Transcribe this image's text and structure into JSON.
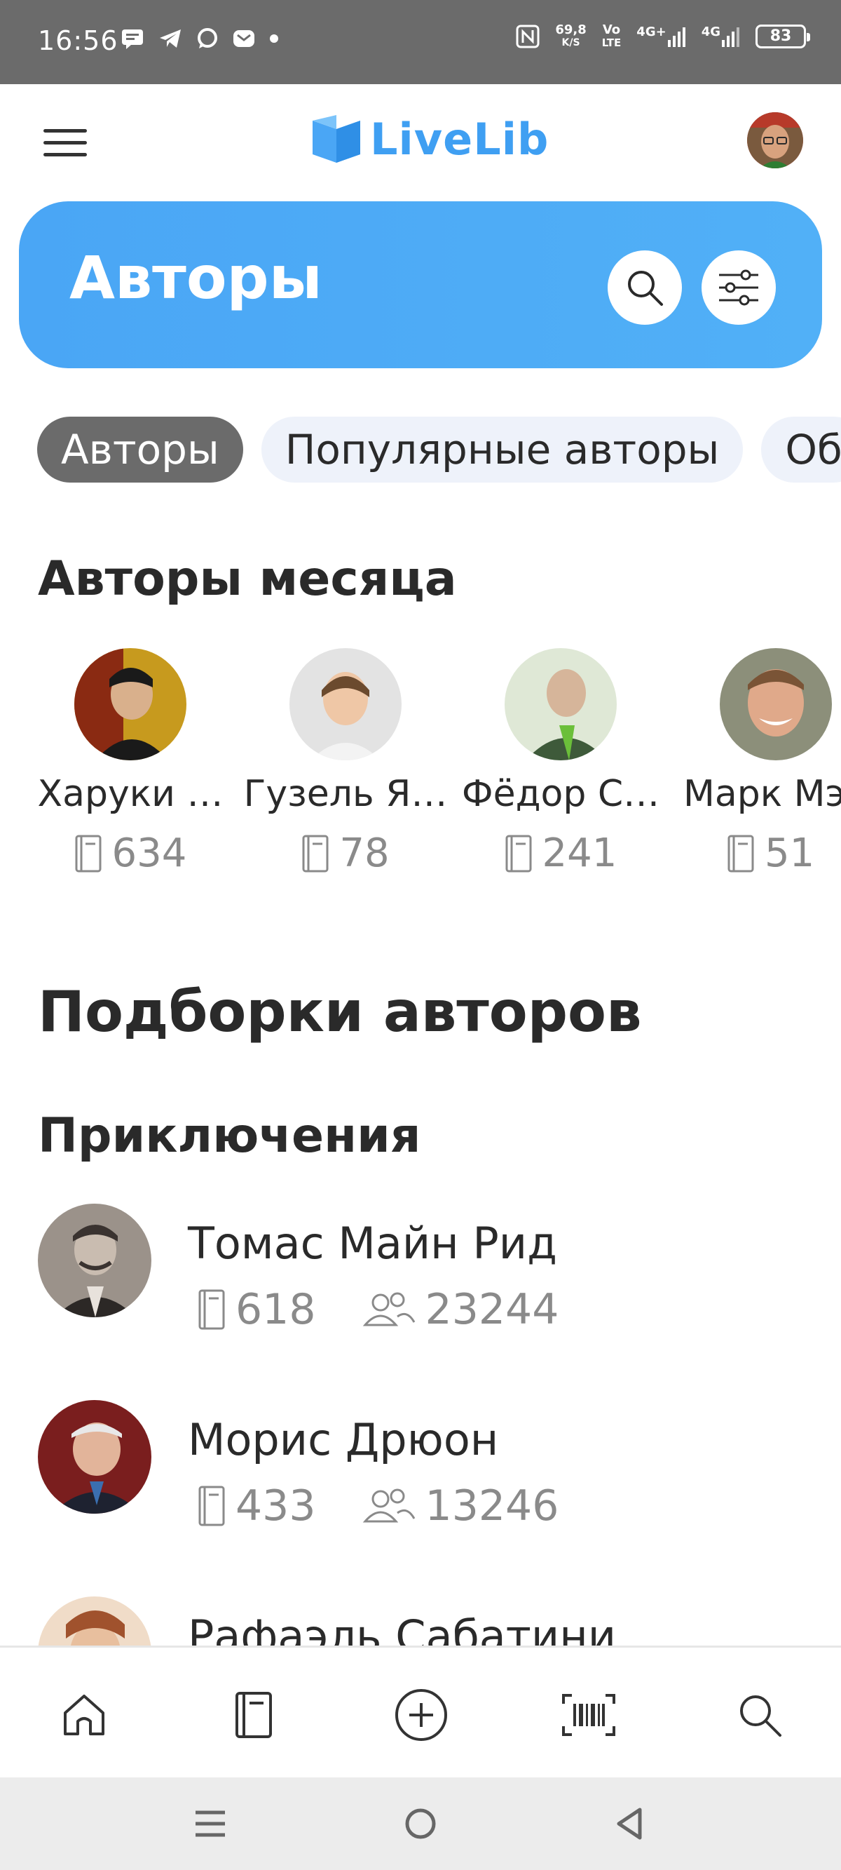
{
  "status_bar": {
    "time": "16:56",
    "speed_value": "69,8",
    "speed_unit": "K/S",
    "volte_top": "Vo",
    "volte_bottom": "LTE",
    "net1": "4G+",
    "net2": "4G",
    "battery": "83"
  },
  "header": {
    "logo_text": "LiveLib"
  },
  "banner": {
    "title": "Авторы"
  },
  "chips": [
    {
      "label": "Авторы",
      "active": true
    },
    {
      "label": "Популярные авторы",
      "active": false
    },
    {
      "label": "Об",
      "active": false
    }
  ],
  "authors_of_month": {
    "title": "Авторы месяца",
    "items": [
      {
        "name": "Харуки …",
        "books": "634"
      },
      {
        "name": "Гузель Я…",
        "books": "78"
      },
      {
        "name": "Фёдор С…",
        "books": "241"
      },
      {
        "name": "Марк Мэ…",
        "books": "51"
      }
    ]
  },
  "collections": {
    "title": "Подборки авторов",
    "adventure": {
      "title": "Приключения",
      "items": [
        {
          "name": "Томас Майн Рид",
          "books": "618",
          "readers": "23244"
        },
        {
          "name": "Морис Дрюон",
          "books": "433",
          "readers": "13246"
        },
        {
          "name": "Рафаэль Сабатини",
          "books": "",
          "readers": ""
        }
      ]
    }
  },
  "colors": {
    "accent": "#4aa6f5",
    "status_bar": "#6b6b6b"
  }
}
